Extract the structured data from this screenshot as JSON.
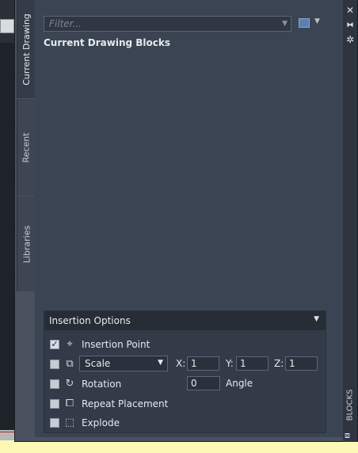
{
  "palette": {
    "title": "BLOCKS",
    "tabs": [
      {
        "label": "Current Drawing",
        "active": true
      },
      {
        "label": "Recent",
        "active": false
      },
      {
        "label": "Libraries",
        "active": false
      }
    ],
    "filter": {
      "placeholder": "Filter..."
    },
    "section_title": "Current Drawing Blocks"
  },
  "insertion_options": {
    "header": "Insertion Options",
    "insertion_point": {
      "label": "Insertion Point",
      "checked": true
    },
    "scale": {
      "checked": false,
      "mode": "Scale",
      "x_label": "X:",
      "x_value": "1",
      "y_label": "Y:",
      "y_value": "1",
      "z_label": "Z:",
      "z_value": "1"
    },
    "rotation": {
      "label": "Rotation",
      "checked": false,
      "angle_value": "0",
      "angle_label": "Angle"
    },
    "repeat_placement": {
      "label": "Repeat Placement",
      "checked": false
    },
    "explode": {
      "label": "Explode",
      "checked": false
    }
  },
  "icons": {
    "close": "close-icon",
    "autohide": "autohide-icon",
    "properties": "properties-icon"
  }
}
